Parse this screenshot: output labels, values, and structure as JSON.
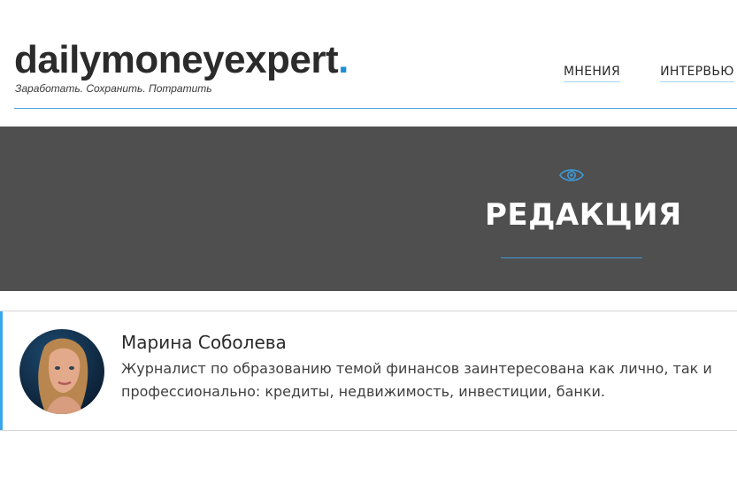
{
  "header": {
    "logo_main": "dailymoneyexpert",
    "logo_dot": ".",
    "tagline": "Заработать. Сохранить. Потратить",
    "nav": [
      "МНЕНИЯ",
      "ИНТЕРВЬЮ"
    ]
  },
  "hero": {
    "icon": "eye-icon",
    "title": "РЕДАКЦИЯ"
  },
  "author": {
    "name": "Марина Соболева",
    "bio": "Журналист по образованию темой финансов заинтересована как лично, так и профессионально: кредиты, недвижимость, инвестиции, банки."
  },
  "colors": {
    "accent": "#1e8fd6",
    "hero_bg": "#4f4f4f",
    "card_accent": "#39a6ea"
  }
}
